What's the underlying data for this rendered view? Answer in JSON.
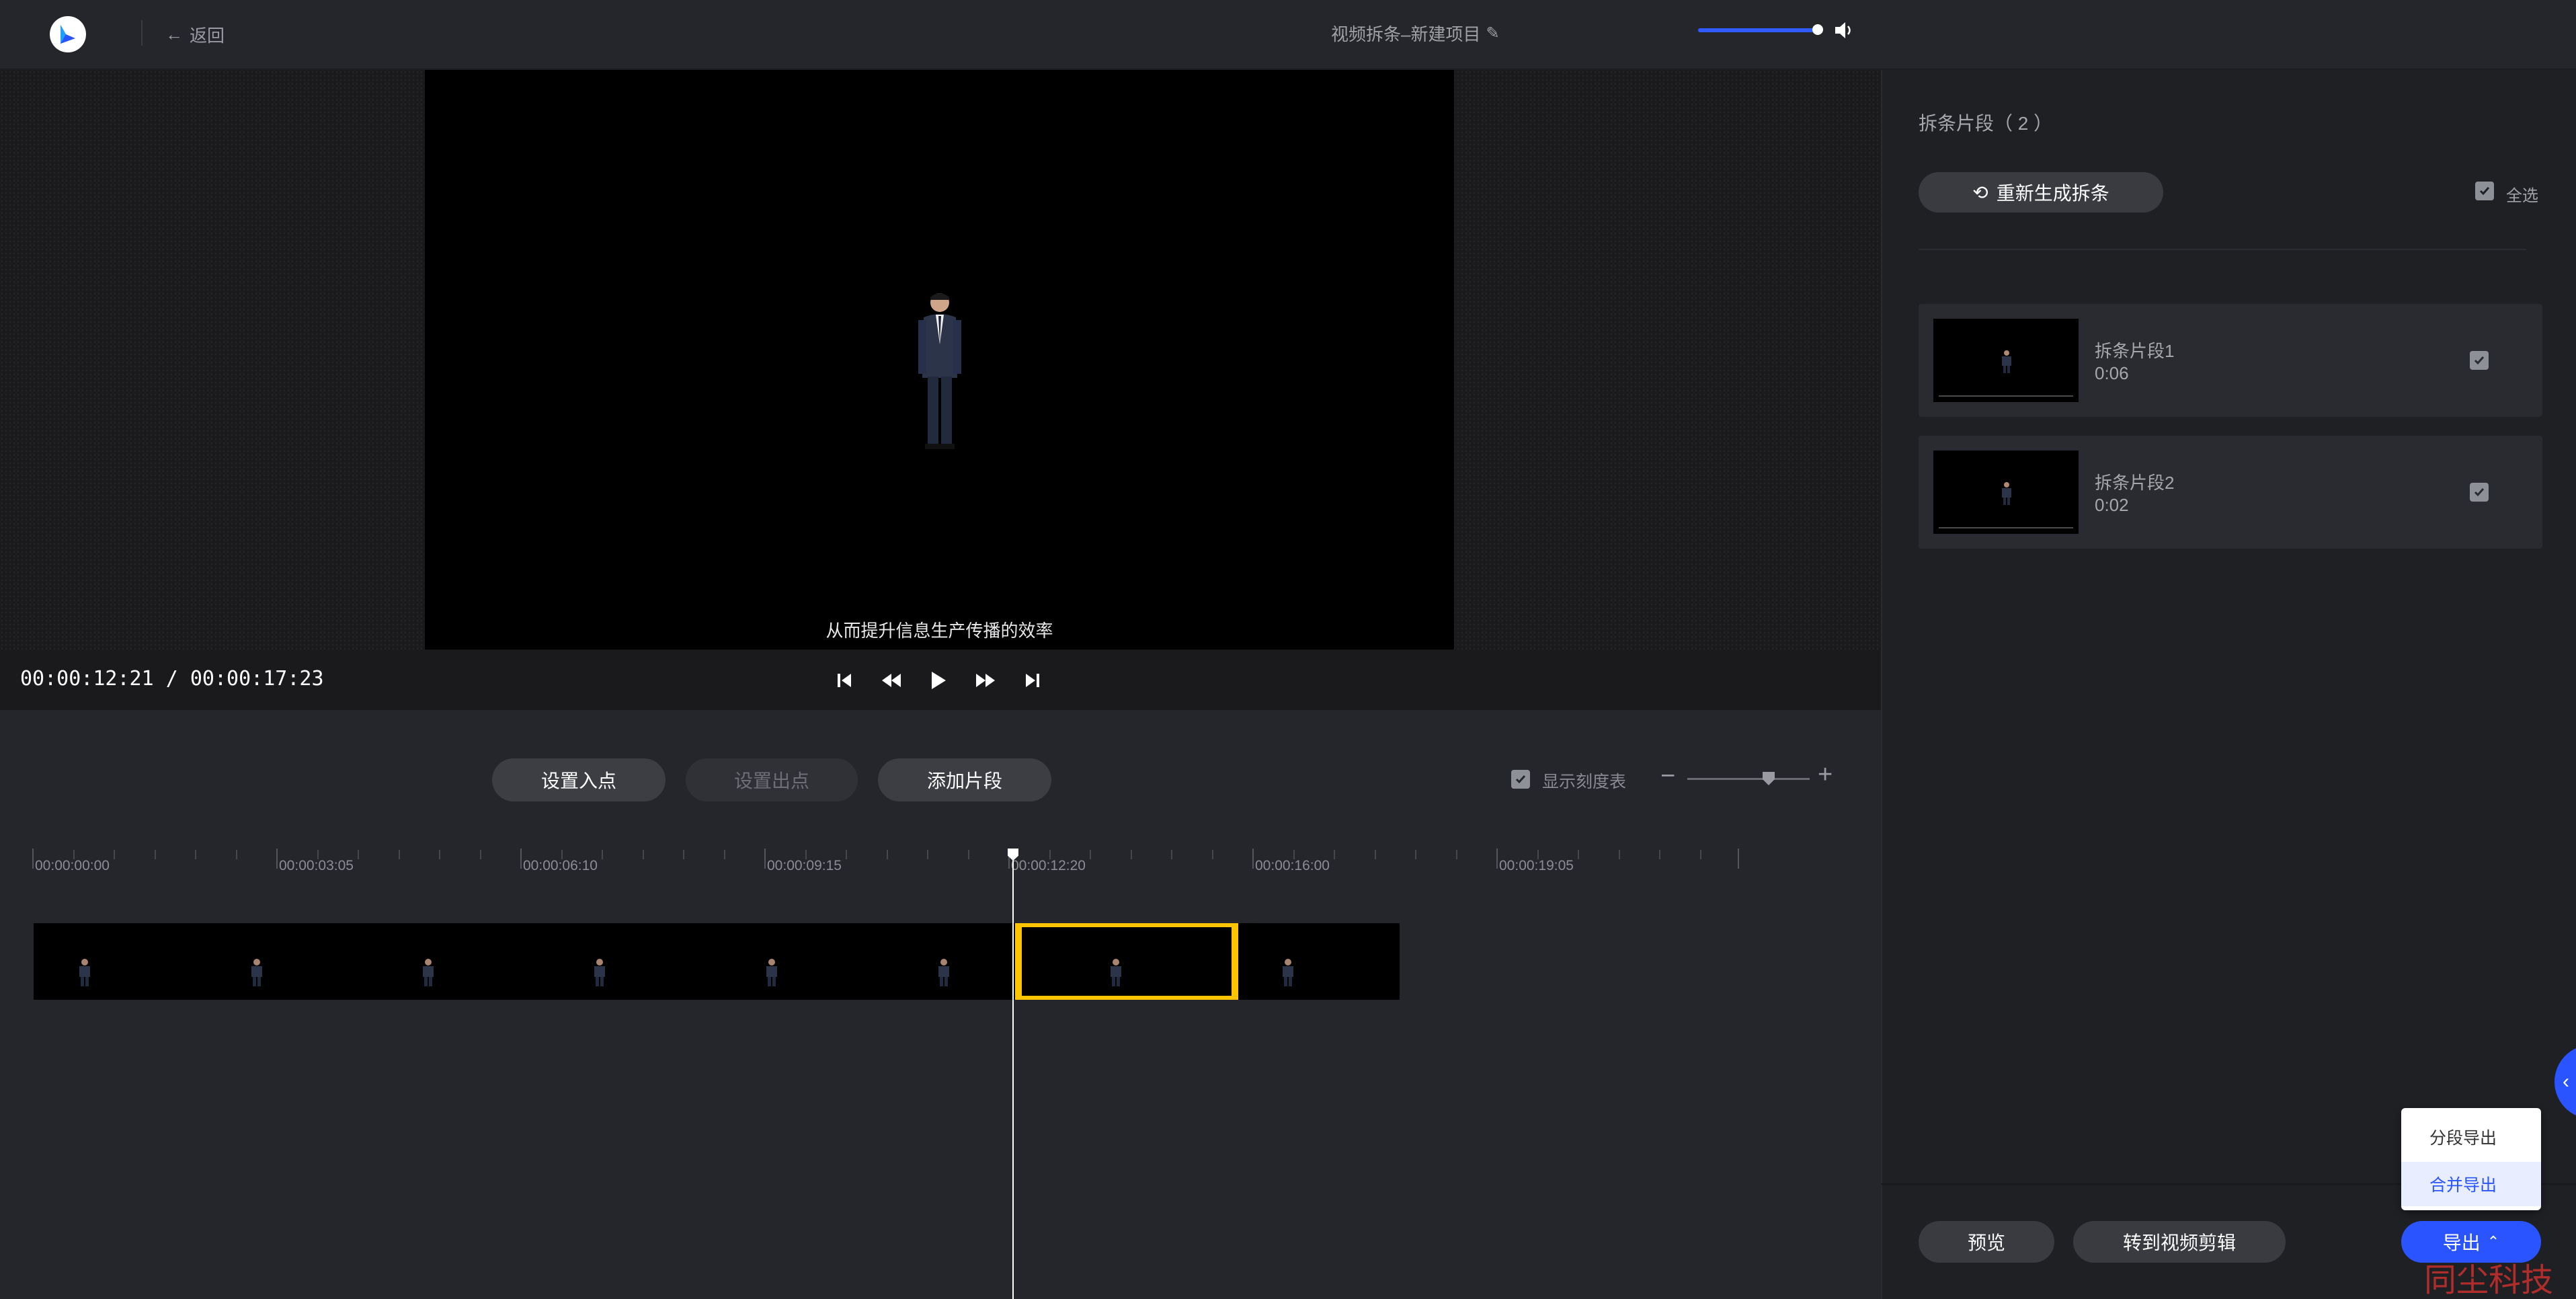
{
  "header": {
    "back_label": "返回",
    "project_title": "视频拆条–新建项目"
  },
  "player": {
    "subtitle": "从而提升信息生产传播的效率",
    "current_time": "00:00:12:21",
    "separator": "/",
    "total_time": "00:00:17:23",
    "volume_percent": 100
  },
  "toolbar": {
    "set_in_label": "设置入点",
    "set_out_label": "设置出点",
    "add_segment_label": "添加片段",
    "show_scale_label": "显示刻度表",
    "show_scale_checked": true,
    "zoom_level_percent": 62
  },
  "timeline": {
    "ticks": [
      "00:00:00:00",
      "00:00:03:05",
      "00:00:06:10",
      "00:00:09:15",
      "00:00:12:20",
      "00:00:16:00",
      "00:00:19:05"
    ],
    "playhead_time": "00:00:12:21"
  },
  "panel": {
    "title": "拆条片段（ 2 ）",
    "regenerate_label": "重新生成拆条",
    "select_all_label": "全选",
    "segments": [
      {
        "name": "拆条片段1",
        "duration": "0:06",
        "checked": true
      },
      {
        "name": "拆条片段2",
        "duration": "0:02",
        "checked": true
      }
    ],
    "preview_label": "预览",
    "to_edit_label": "转到视频剪辑",
    "export_label": "导出",
    "export_menu": [
      {
        "label": "分段导出"
      },
      {
        "label": "合并导出"
      }
    ]
  },
  "watermark": "同尘科技",
  "colors": {
    "accent": "#2a54ff",
    "selection": "#ffc400",
    "background": "#25262b",
    "panel": "#1f2024"
  },
  "icons": {
    "back": "arrow-left-icon",
    "edit": "pencil-icon",
    "skip_start": "skip-start-icon",
    "rewind": "rewind-icon",
    "play": "play-icon",
    "forward": "fast-forward-icon",
    "skip_end": "skip-end-icon",
    "volume": "volume-icon",
    "regenerate": "refresh-icon",
    "export_caret": "chevron-up-icon",
    "side_tab": "chevron-left-icon"
  }
}
